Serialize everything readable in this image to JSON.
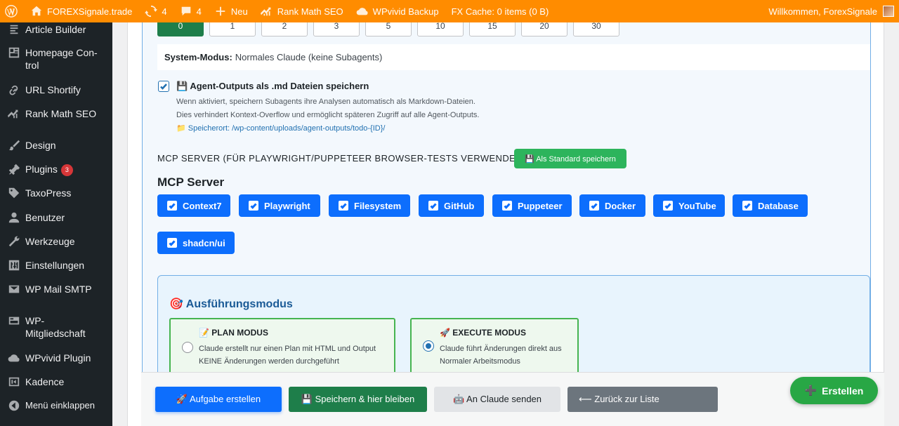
{
  "adminbar": {
    "site_name": "FOREXSignale.trade",
    "updates_count": "4",
    "comments_count": "4",
    "new_label": "Neu",
    "rankmath_label": "Rank Math SEO",
    "wpvivid_label": "WPvivid Backup",
    "fxcache_label": "FX Cache: 0 items (0 B)",
    "welcome": "Willkommen, ForexSignale"
  },
  "sidebar": {
    "items": [
      {
        "label": "Article Builder",
        "icon": "article-icon"
      },
      {
        "label": "Homepage Con-trol",
        "icon": "homepage-icon"
      },
      {
        "label": "URL Shortify",
        "icon": "link-icon"
      },
      {
        "label": "Rank Math SEO",
        "icon": "rankmath-icon"
      },
      {
        "label": "Design",
        "icon": "brush-icon"
      },
      {
        "label": "Plugins",
        "icon": "plugin-icon",
        "badge": "3"
      },
      {
        "label": "TaxoPress",
        "icon": "tag-icon"
      },
      {
        "label": "Benutzer",
        "icon": "user-icon"
      },
      {
        "label": "Werkzeuge",
        "icon": "wrench-icon"
      },
      {
        "label": "Einstellungen",
        "icon": "settings-icon"
      },
      {
        "label": "WP Mail SMTP",
        "icon": "mail-icon"
      },
      {
        "label": "WP-Mitgliedschaft",
        "icon": "membership-icon"
      },
      {
        "label": "WPvivid Plugin",
        "icon": "cloud-icon"
      },
      {
        "label": "Kadence",
        "icon": "kadence-icon"
      }
    ],
    "collapse_label": "Menü einklappen"
  },
  "subagents": {
    "options": [
      "0",
      "1",
      "2",
      "3",
      "5",
      "10",
      "15",
      "20",
      "30"
    ],
    "selected": "0"
  },
  "system_mode": {
    "label": "System-Modus:",
    "value": "Normales Claude (keine Subagents)"
  },
  "agent_outputs": {
    "checked": true,
    "title": "💾 Agent-Outputs als .md Dateien speichern",
    "desc1": "Wenn aktiviert, speichern Subagents ihre Analysen automatisch als Markdown-Dateien.",
    "desc2": "Dies verhindert Kontext-Overflow und ermöglicht späteren Zugriff auf alle Agent-Outputs.",
    "path_prefix": "📁 Speicherort: ",
    "path": "/wp-content/uploads/agent-outputs/todo-{ID}/"
  },
  "mcp": {
    "heading": "MCP SERVER (FÜR PLAYWRIGHT/PUPPETEER BROWSER-TESTS VERWENDEN)",
    "save_default_label": "💾 Als Standard speichern",
    "title": "MCP Server",
    "servers": [
      "Context7",
      "Playwright",
      "Filesystem",
      "GitHub",
      "Puppeteer",
      "Docker",
      "YouTube",
      "Database",
      "shadcn/ui"
    ]
  },
  "execution": {
    "title": "🎯 Ausführungsmodus",
    "plan": {
      "title": "📝 PLAN MODUS",
      "desc1": "Claude erstellt nur einen Plan mit HTML und Output",
      "desc2": "KEINE Änderungen werden durchgeführt",
      "selected": false
    },
    "execute": {
      "title": "🚀 EXECUTE MODUS",
      "desc1": "Claude führt Änderungen direkt aus",
      "desc2": "Normaler Arbeitsmodus",
      "selected": true
    }
  },
  "bottombar": {
    "create_task": "🚀 Aufgabe erstellen",
    "save_stay": "💾 Speichern & hier bleiben",
    "send_claude": "🤖 An Claude senden",
    "back_list": "⟵ Zurück zur Liste"
  },
  "fab": {
    "label": "Erstellen",
    "icon": "➕"
  },
  "colors": {
    "adminbar": "#ff8c00",
    "sidebar": "#1d2327",
    "primary_blue": "#0d6efd",
    "green": "#1e7e4a",
    "success": "#28a745"
  }
}
